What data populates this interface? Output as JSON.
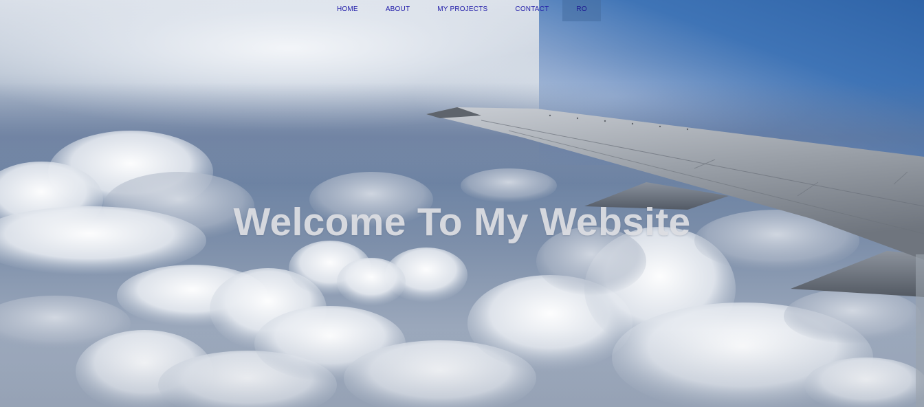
{
  "nav": {
    "items": [
      {
        "label": "HOME"
      },
      {
        "label": "ABOUT"
      },
      {
        "label": "MY PROJECTS"
      },
      {
        "label": "CONTACT"
      },
      {
        "label": "RO"
      }
    ]
  },
  "hero": {
    "title": "Welcome To My Website"
  },
  "colors": {
    "nav_text": "#1f1aa8",
    "title_text": "#dedfe3",
    "active_nav_bg": "#466ea0"
  }
}
